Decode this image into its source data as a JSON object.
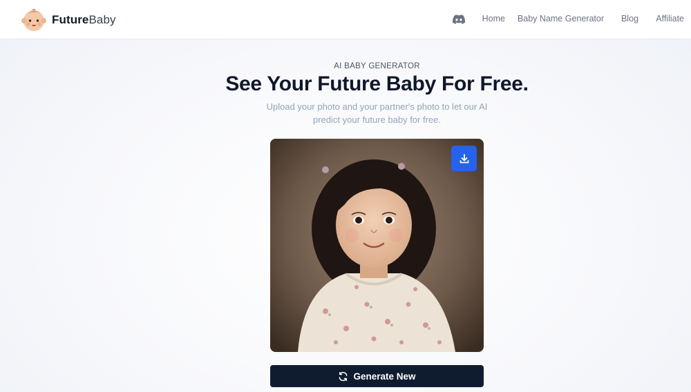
{
  "brand": {
    "name_bold": "Future",
    "name_light": "Baby"
  },
  "nav": {
    "discord_icon": "discord-icon",
    "items": [
      "Home",
      "Baby Name Generator",
      "Blog",
      "Affiliate"
    ]
  },
  "hero": {
    "eyebrow": "AI BABY GENERATOR",
    "title": "See Your Future Baby For Free.",
    "subtitle": "Upload your photo and your partner's photo to let our AI predict your future baby for free."
  },
  "result": {
    "image_alt": "Generated portrait of a smiling toddler girl with dark hair in a floral dress",
    "download_icon": "download-icon"
  },
  "actions": {
    "generate_label": "Generate New",
    "generate_icon": "refresh-icon"
  },
  "colors": {
    "accent_blue": "#2563eb",
    "button_dark": "#0f1c30",
    "heading": "#0f172a",
    "muted": "#94a3b8"
  }
}
